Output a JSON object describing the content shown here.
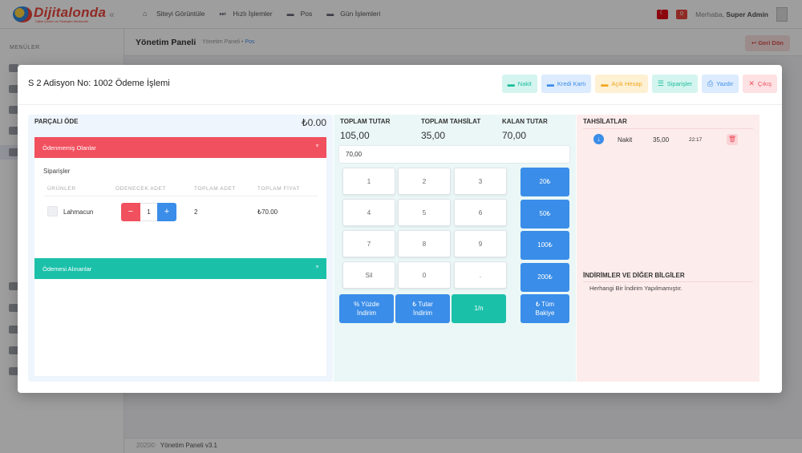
{
  "app": {
    "logo_text": "Dijitalonda",
    "logo_tagline": "Dijital Çözüm ve Stratejiler Merkezidir",
    "topnav": [
      {
        "label": "Siteyi Görüntüle",
        "icon": "home-icon"
      },
      {
        "label": "Hızlı İşlemler",
        "icon": "fast-forward-icon"
      },
      {
        "label": "Pos",
        "icon": "card-icon"
      },
      {
        "label": "Gün İşlemleri",
        "icon": "card-icon"
      }
    ],
    "notification_count": "0",
    "greeting": "Merhaba,",
    "user_name": "Super Admin",
    "menu_title": "MENÜLER",
    "page_title": "Yönetim Paneli",
    "breadcrumb": [
      "Yönetim Paneli",
      "Pos"
    ],
    "back_button": "Geri Dön",
    "footer_year": "2020©",
    "footer_text": "Yönetim Paneli v3.1"
  },
  "modal": {
    "title": "S 2 Adisyon No: 1002 Ödeme İşlemi",
    "buttons": [
      {
        "label": "Nakit",
        "icon": "cash-icon",
        "style": "b-nakit"
      },
      {
        "label": "Kredi Kartı",
        "icon": "credit-card-icon",
        "style": "b-kredi"
      },
      {
        "label": "Açık Hesap",
        "icon": "open-account-icon",
        "style": "b-acik"
      },
      {
        "label": "Siparişler",
        "icon": "list-icon",
        "style": "b-sip"
      },
      {
        "label": "Yazdır",
        "icon": "printer-icon",
        "style": "b-yaz"
      },
      {
        "label": "Çıkış",
        "icon": "close-icon",
        "style": "b-cik"
      }
    ]
  },
  "partial": {
    "title": "PARÇALI ÖDE",
    "amount": "₺0.00",
    "unpaid_header": "Ödenmemiş Olanlar",
    "orders_label": "Siparişler",
    "columns": [
      "ÜRÜNLER",
      "ÖDENECEK ADET",
      "TOPLAM ADET",
      "TOPLAM FİYAT"
    ],
    "rows": [
      {
        "name": "Lahmacun",
        "pay_qty": "1",
        "total_qty": "2",
        "total_price": "₺70.00"
      }
    ],
    "paid_header": "Ödemesi Alınanlar"
  },
  "totals": {
    "total_label": "TOPLAM TUTAR",
    "total_value": "105,00",
    "collected_label": "TOPLAM TAHSİLAT",
    "collected_value": "35,00",
    "remaining_label": "KALAN TUTAR",
    "remaining_value": "70,00",
    "input_value": "70,00"
  },
  "keypad": {
    "keys": [
      "1",
      "2",
      "3",
      "4",
      "5",
      "6",
      "7",
      "8",
      "9",
      "Sil",
      "0",
      "."
    ],
    "quick": [
      "20₺",
      "50₺",
      "100₺",
      "200₺"
    ],
    "percent_discount": [
      "% Yüzde",
      "İndirim"
    ],
    "amount_discount": [
      "₺ Tutar",
      "İndirim"
    ],
    "split": "1/n",
    "all_balance": [
      "₺ Tüm",
      "Bakiye"
    ]
  },
  "collections": {
    "title": "TAHSİLATLAR",
    "items": [
      {
        "type": "Nakit",
        "amount": "35,00",
        "time": "22:17"
      }
    ],
    "discount_title": "İNDİRİMLER VE DİĞER BİLGİLER",
    "discount_text": "Herhangi Bir İndirim Yapılmamıştır."
  }
}
